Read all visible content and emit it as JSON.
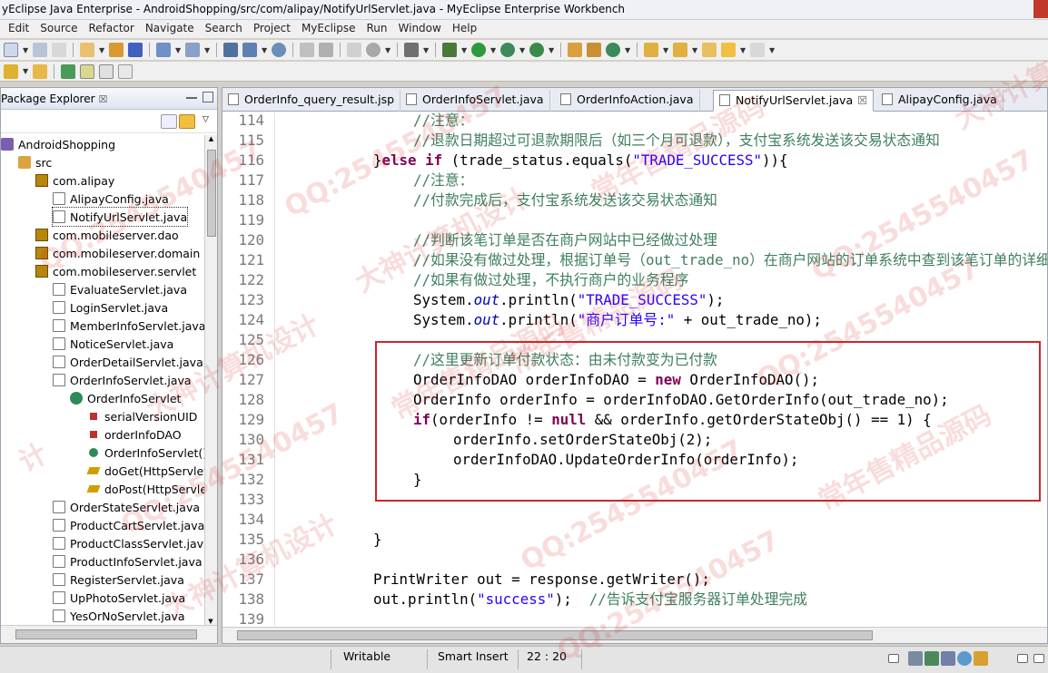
{
  "window": {
    "title": "yEclipse Java Enterprise - AndroidShopping/src/com/alipay/NotifyUrlServlet.java - MyEclipse Enterprise Workbench"
  },
  "menu": [
    "Edit",
    "Source",
    "Refactor",
    "Navigate",
    "Search",
    "Project",
    "MyEclipse",
    "Run",
    "Window",
    "Help"
  ],
  "package_explorer": {
    "title": "Package Explorer",
    "close": "☒",
    "tree": [
      {
        "label": "AndroidShopping",
        "icon": "project-icon"
      },
      {
        "label": "src",
        "icon": "source-folder-icon"
      },
      {
        "label": "com.alipay",
        "icon": "package-icon"
      },
      {
        "label": "AlipayConfig.java",
        "icon": "java-file-icon"
      },
      {
        "label": "NotifyUrlServlet.java",
        "icon": "java-file-icon"
      },
      {
        "label": "com.mobileserver.dao",
        "icon": "package-icon"
      },
      {
        "label": "com.mobileserver.domain",
        "icon": "package-icon"
      },
      {
        "label": "com.mobileserver.servlet",
        "icon": "package-icon"
      },
      {
        "label": "EvaluateServlet.java",
        "icon": "java-file-icon"
      },
      {
        "label": "LoginServlet.java",
        "icon": "java-file-icon"
      },
      {
        "label": "MemberInfoServlet.java",
        "icon": "java-file-icon"
      },
      {
        "label": "NoticeServlet.java",
        "icon": "java-file-icon"
      },
      {
        "label": "OrderDetailServlet.java",
        "icon": "java-file-icon"
      },
      {
        "label": "OrderInfoServlet.java",
        "icon": "java-file-icon"
      },
      {
        "label": "OrderInfoServlet",
        "icon": "class-icon"
      },
      {
        "label": "serialVersionUID",
        "icon": "field-icon"
      },
      {
        "label": "orderInfoDAO",
        "icon": "field-icon"
      },
      {
        "label": "OrderInfoServlet()",
        "icon": "constructor-icon"
      },
      {
        "label": "doGet(HttpServletR",
        "icon": "method-icon"
      },
      {
        "label": "doPost(HttpServlet",
        "icon": "method-icon"
      },
      {
        "label": "OrderStateServlet.java",
        "icon": "java-file-icon"
      },
      {
        "label": "ProductCartServlet.java",
        "icon": "java-file-icon"
      },
      {
        "label": "ProductClassServlet.java",
        "icon": "java-file-icon"
      },
      {
        "label": "ProductInfoServlet.java",
        "icon": "java-file-icon"
      },
      {
        "label": "RegisterServlet.java",
        "icon": "java-file-icon"
      },
      {
        "label": "UpPhotoServlet.java",
        "icon": "java-file-icon"
      },
      {
        "label": "YesOrNoServlet.java",
        "icon": "java-file-icon"
      }
    ]
  },
  "editor": {
    "tabs": [
      {
        "label": "OrderInfo_query_result.jsp",
        "active": false
      },
      {
        "label": "OrderInfoServlet.java",
        "active": false
      },
      {
        "label": "OrderInfoAction.java",
        "active": false
      },
      {
        "label": "NotifyUrlServlet.java",
        "active": true,
        "close": "☒"
      },
      {
        "label": "AlipayConfig.java",
        "active": false
      }
    ],
    "lines": [
      {
        "n": "114",
        "indent": 4,
        "parts": [
          [
            "cm",
            "//注意："
          ]
        ]
      },
      {
        "n": "115",
        "indent": 4,
        "parts": [
          [
            "cm",
            "//退款日期超过可退款期限后（如三个月可退款），支付宝系统发送该交易状态通知"
          ]
        ]
      },
      {
        "n": "116",
        "indent": 0,
        "parts": [
          [
            "",
            "}"
          ],
          [
            "kw",
            "else"
          ],
          [
            "",
            " "
          ],
          [
            "kw",
            "if"
          ],
          [
            "",
            " (trade_status.equals("
          ],
          [
            "st",
            "\"TRADE_SUCCESS\""
          ],
          [
            "",
            "))"
          ],
          [
            "",
            "{"
          ]
        ]
      },
      {
        "n": "117",
        "indent": 4,
        "parts": [
          [
            "cm",
            "//注意："
          ]
        ]
      },
      {
        "n": "118",
        "indent": 4,
        "parts": [
          [
            "cm",
            "//付款完成后，支付宝系统发送该交易状态通知"
          ]
        ]
      },
      {
        "n": "119",
        "indent": 0,
        "parts": []
      },
      {
        "n": "120",
        "indent": 4,
        "parts": [
          [
            "cm",
            "//判断该笔订单是否在商户网站中已经做过处理"
          ]
        ]
      },
      {
        "n": "121",
        "indent": 4,
        "parts": [
          [
            "cm",
            "//如果没有做过处理，根据订单号（out_trade_no）在商户网站的订单系统中查到该笔订单的详细，"
          ]
        ]
      },
      {
        "n": "122",
        "indent": 4,
        "parts": [
          [
            "cm",
            "//如果有做过处理，不执行商户的业务程序"
          ]
        ]
      },
      {
        "n": "123",
        "indent": 4,
        "parts": [
          [
            "",
            "System."
          ],
          [
            "fd",
            "out"
          ],
          [
            "",
            ".println("
          ],
          [
            "st",
            "\"TRADE_SUCCESS\""
          ],
          [
            "",
            ");"
          ]
        ]
      },
      {
        "n": "124",
        "indent": 4,
        "parts": [
          [
            "",
            "System."
          ],
          [
            "fd",
            "out"
          ],
          [
            "",
            ".println("
          ],
          [
            "st",
            "\"商户订单号:\""
          ],
          [
            "",
            " + out_trade_no);"
          ]
        ]
      },
      {
        "n": "125",
        "indent": 0,
        "parts": []
      },
      {
        "n": "126",
        "indent": 4,
        "parts": [
          [
            "cm",
            "//这里更新订单付款状态：由未付款变为已付款"
          ]
        ]
      },
      {
        "n": "127",
        "indent": 4,
        "parts": [
          [
            "",
            "OrderInfoDAO orderInfoDAO = "
          ],
          [
            "kw",
            "new"
          ],
          [
            "",
            " OrderInfoDAO();"
          ]
        ]
      },
      {
        "n": "128",
        "indent": 4,
        "parts": [
          [
            "",
            "OrderInfo orderInfo = orderInfoDAO.GetOrderInfo(out_trade_no);"
          ]
        ]
      },
      {
        "n": "129",
        "indent": 4,
        "parts": [
          [
            "kw",
            "if"
          ],
          [
            "",
            "(orderInfo != "
          ],
          [
            "kw",
            "null"
          ],
          [
            "",
            " && orderInfo.getOrderStateObj() == 1) {"
          ]
        ]
      },
      {
        "n": "130",
        "indent": 8,
        "parts": [
          [
            "",
            "orderInfo.setOrderStateObj(2);"
          ]
        ]
      },
      {
        "n": "131",
        "indent": 8,
        "parts": [
          [
            "",
            "orderInfoDAO.UpdateOrderInfo(orderInfo);"
          ]
        ]
      },
      {
        "n": "132",
        "indent": 4,
        "parts": [
          [
            "",
            "}"
          ]
        ]
      },
      {
        "n": "133",
        "indent": 0,
        "parts": []
      },
      {
        "n": "134",
        "indent": 0,
        "parts": []
      },
      {
        "n": "135",
        "indent": 0,
        "parts": [
          [
            "",
            "}"
          ]
        ]
      },
      {
        "n": "136",
        "indent": 0,
        "parts": []
      },
      {
        "n": "137",
        "indent": 0,
        "parts": [
          [
            "",
            "PrintWriter out = response.getWriter();"
          ]
        ]
      },
      {
        "n": "138",
        "indent": 0,
        "parts": [
          [
            "",
            "out.println("
          ],
          [
            "st",
            "\"success\""
          ],
          [
            "",
            ");  "
          ],
          [
            "cm",
            "//告诉支付宝服务器订单处理完成"
          ]
        ]
      },
      {
        "n": "139",
        "indent": 0,
        "parts": []
      }
    ]
  },
  "status": {
    "mode": "Writable",
    "insert": "Smart Insert",
    "position": "22 : 20"
  },
  "watermarks": [
    "QQ:2545540457",
    "大神计算机设计",
    "常年售精品源码",
    "QQ:2545540457",
    "大神计算机设计",
    "常年售精品源码",
    "QQ:2545540457",
    "大神计算机设计",
    "常年售精品源码",
    "QQ:2545540457",
    "计",
    "QQ:2545540457",
    "常年售精品源码",
    "QQ:2545540457",
    "大神计算机设计",
    "QQ:2545540457"
  ]
}
